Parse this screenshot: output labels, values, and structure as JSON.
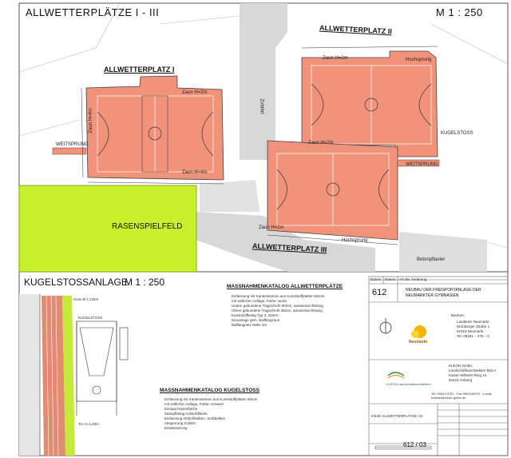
{
  "header": {
    "title": "ALLWETTERPLÄTZE  I - III",
    "scale": "M 1 : 250"
  },
  "plan": {
    "place_1": "ALLWETTERPLATZ I",
    "place_2": "ALLWETTERPLATZ II",
    "place_3": "ALLWETTERPLATZ III",
    "lawn": "RASENSPIELFELD",
    "kugelstoss": "KUGELSTOSS",
    "weitsprung": "WEITSPRUNG",
    "hochsprung": "Hochsprung",
    "zufahrt": "Zufahrt",
    "betonpflaster": "Betonpflaster",
    "fence_labels": {
      "p1_top": "Zaun H=2m",
      "p1_bottom": "Zaun H=4m",
      "p1_left": "Zaun H=4m",
      "p2_top": "Zaun H=2m",
      "p3_top": "Zaun H=2m",
      "p3_bottom": "Zaun H=2m"
    }
  },
  "kugel_section": {
    "title": "KUGELSTOSSANLAGE",
    "scale": "M 1 : 250",
    "catalog_title": "MASSNAHMENKATALOG KUGELSTOSS",
    "items": [
      "Einfassung mit Kantensteinen aus Kunststoffplatten 60mm",
      "mit seitlicher Auflage, Farbe: schwarz",
      "Einsaat Rasenfläche",
      "Stampfbelag Aufstoßfläche",
      "Einfassung Abstoßbalken, Stoßbalken",
      "Absperrung Zufahrt",
      "Entwässerung"
    ],
    "dimension": "Kreis Ø 2,135m",
    "gate_label": "Tor H=1,20m"
  },
  "catalog": {
    "title": "MASSNAHMENKATALOG ALLWETTERPLÄTZE",
    "items": [
      "Einfassung mit Kantensteinen aus Kunststoffplatten 60mm",
      "mit seitlicher Auflage, Farbe: weiss",
      "Untere gebundene Tragschicht 80mm, wasserdurchlässig",
      "Obere gebundene Tragschicht 35mm, wasserdurchlässig",
      "Kunststoffbelag Typ 3, 20mm",
      "Neuanlage gem. Ballfangzaun",
      "Ballfangnetz Nähe 4m"
    ]
  },
  "title_block": {
    "plan_number": "612",
    "project_title": "NEUBAU DER FREISPORTANLAGE DER NEUMARKTER GYMNASIEN",
    "client_label": "Bauherr:",
    "client_lines": [
      "Landkreis Neumarkt",
      "Nürnberger Straße 1",
      "92318 Neumarkt",
      "Tel. 09181 – 470 – 0"
    ],
    "architect_lines": [
      "KLEON GmbH",
      "Landschaftsarchitekten BDLA",
      "Kaiser-Wilhelm-Ring 14",
      "92224 Amberg"
    ],
    "contact": "Tel. 09621/3751 · Fax 09621/6370 · e-mail: kontakt@kleon-gmbh.de",
    "brand": "KLEON Landschaftsarchitekten",
    "logo_text": "Neumarkt",
    "revision_headers": [
      "Datum",
      "Datum",
      "Art der Änderung"
    ],
    "plan_content": "Inhalt: ALLWETTERPLÄTZE I-III",
    "sheet_number": "612 / 03"
  },
  "colors": {
    "court_fill": "#f1937b",
    "lawn_fill": "#c7f22b",
    "track_fill": "#e38a73",
    "track_green": "#c7ea3a",
    "road_fill": "#d6d6d6",
    "line_color": "#333333"
  }
}
